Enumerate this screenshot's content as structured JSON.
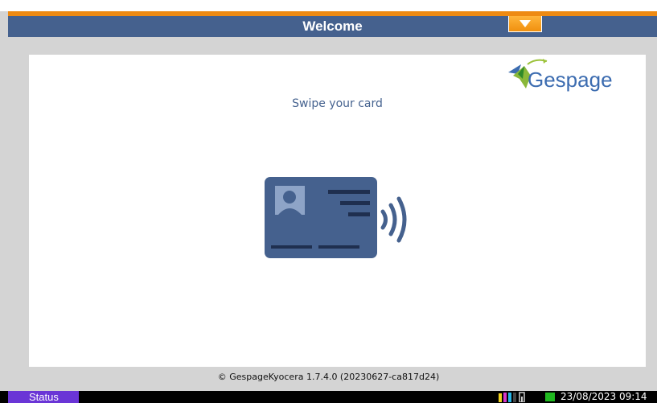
{
  "header": {
    "title": "Welcome",
    "dropdown_icon": "triangle-down-icon",
    "accent_color": "#ee8a12",
    "bar_color": "#45618e"
  },
  "panel": {
    "logo_text": "Gespage",
    "prompt": "Swipe your card",
    "illustration": "contactless-card-icon"
  },
  "footer": {
    "copyright": "© GespageKyocera 1.7.4.0 (20230627-ca817d24)"
  },
  "status_bar": {
    "status_label": "Status",
    "datetime": "23/08/2023  09:14",
    "toner_icon": "toner-levels-icon",
    "network_icon": "network-status-icon"
  }
}
